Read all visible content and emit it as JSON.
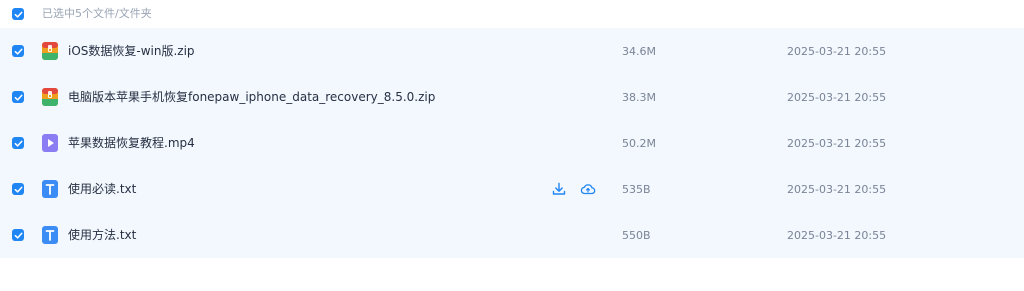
{
  "header": {
    "selection_text": "已选中5个文件/文件夹"
  },
  "files": [
    {
      "name": "iOS数据恢复-win版.zip",
      "size": "34.6M",
      "date": "2025-03-21 20:55",
      "icon": "zip-archive-icon"
    },
    {
      "name": "电脑版本苹果手机恢复fonepaw_iphone_data_recovery_8.5.0.zip",
      "size": "38.3M",
      "date": "2025-03-21 20:55",
      "icon": "zip-archive-icon"
    },
    {
      "name": "苹果数据恢复教程.mp4",
      "size": "50.2M",
      "date": "2025-03-21 20:55",
      "icon": "video-file-icon"
    },
    {
      "name": "使用必读.txt",
      "size": "535B",
      "date": "2025-03-21 20:55",
      "icon": "text-file-icon"
    },
    {
      "name": "使用方法.txt",
      "size": "550B",
      "date": "2025-03-21 20:55",
      "icon": "text-file-icon"
    }
  ],
  "hover_actions": [
    "download-icon",
    "cloud-save-icon"
  ],
  "colors": {
    "accent": "#1f86f4",
    "row_bg": "#f3f8fe",
    "muted_text": "#9aa4b5"
  }
}
